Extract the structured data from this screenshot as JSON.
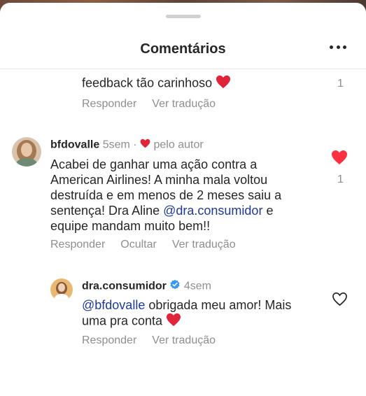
{
  "header": {
    "title": "Comentários"
  },
  "comments": [
    {
      "text": "feedback tão carinhoso",
      "emoji": "❤️",
      "actions": [
        "Responder",
        "Ver tradução"
      ],
      "like_count": "1"
    },
    {
      "username": "bfdovalle",
      "time": "5sem",
      "author_label": "pelo autor",
      "text_lines": [
        "Acabei de ganhar uma ação contra a",
        "American Airlines! A minha mala voltou",
        "destruída e em menos de 2 meses saiu a",
        "sentença! Dra Aline "
      ],
      "mention": "@dra.consumidor",
      "text_after_mention": " e",
      "text_last": "equipe mandam muito bem!!",
      "actions": [
        "Responder",
        "Ocultar",
        "Ver tradução"
      ],
      "like_count": "1",
      "liked": true
    },
    {
      "username": "dra.consumidor",
      "verified": true,
      "time": "4sem",
      "mention": "@bfdovalle",
      "text_after_mention": " obrigada meu amor! Mais",
      "text_line2": "uma pra conta",
      "emoji": "❤️",
      "actions": [
        "Responder",
        "Ver tradução"
      ],
      "liked": false
    }
  ],
  "colors": {
    "like": "#ff3040",
    "mention": "#1f3a93",
    "verified": "#3897f0",
    "muted": "#8e8e8e"
  }
}
